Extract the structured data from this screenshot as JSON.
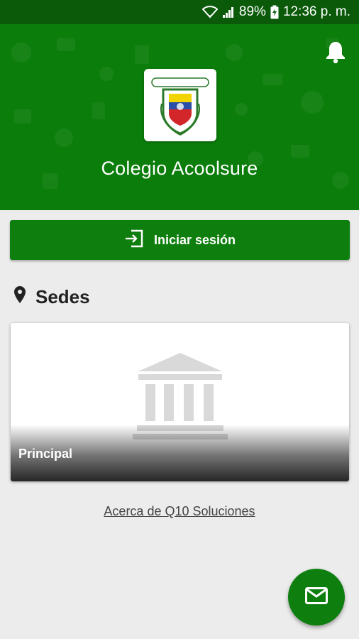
{
  "status_bar": {
    "battery": "89%",
    "time": "12:36 p. m."
  },
  "header": {
    "school_name": "Colegio Acoolsure"
  },
  "actions": {
    "login_label": "Iniciar sesión"
  },
  "sedes": {
    "title": "Sedes",
    "items": [
      {
        "label": "Principal"
      }
    ]
  },
  "footer": {
    "about_link": "Acerca de Q10 Soluciones"
  },
  "icons": {
    "status": [
      "wifi-icon",
      "signal-icon",
      "battery-icon"
    ],
    "header": [
      "bell-icon",
      "school-logo"
    ],
    "login": "login-icon",
    "section": "location-pin-icon",
    "card": "building-icon",
    "fab": "mail-icon"
  },
  "colors": {
    "primary_green": "#0b7d0b",
    "status_bar": "#0a5a0a",
    "background": "#ececec"
  }
}
